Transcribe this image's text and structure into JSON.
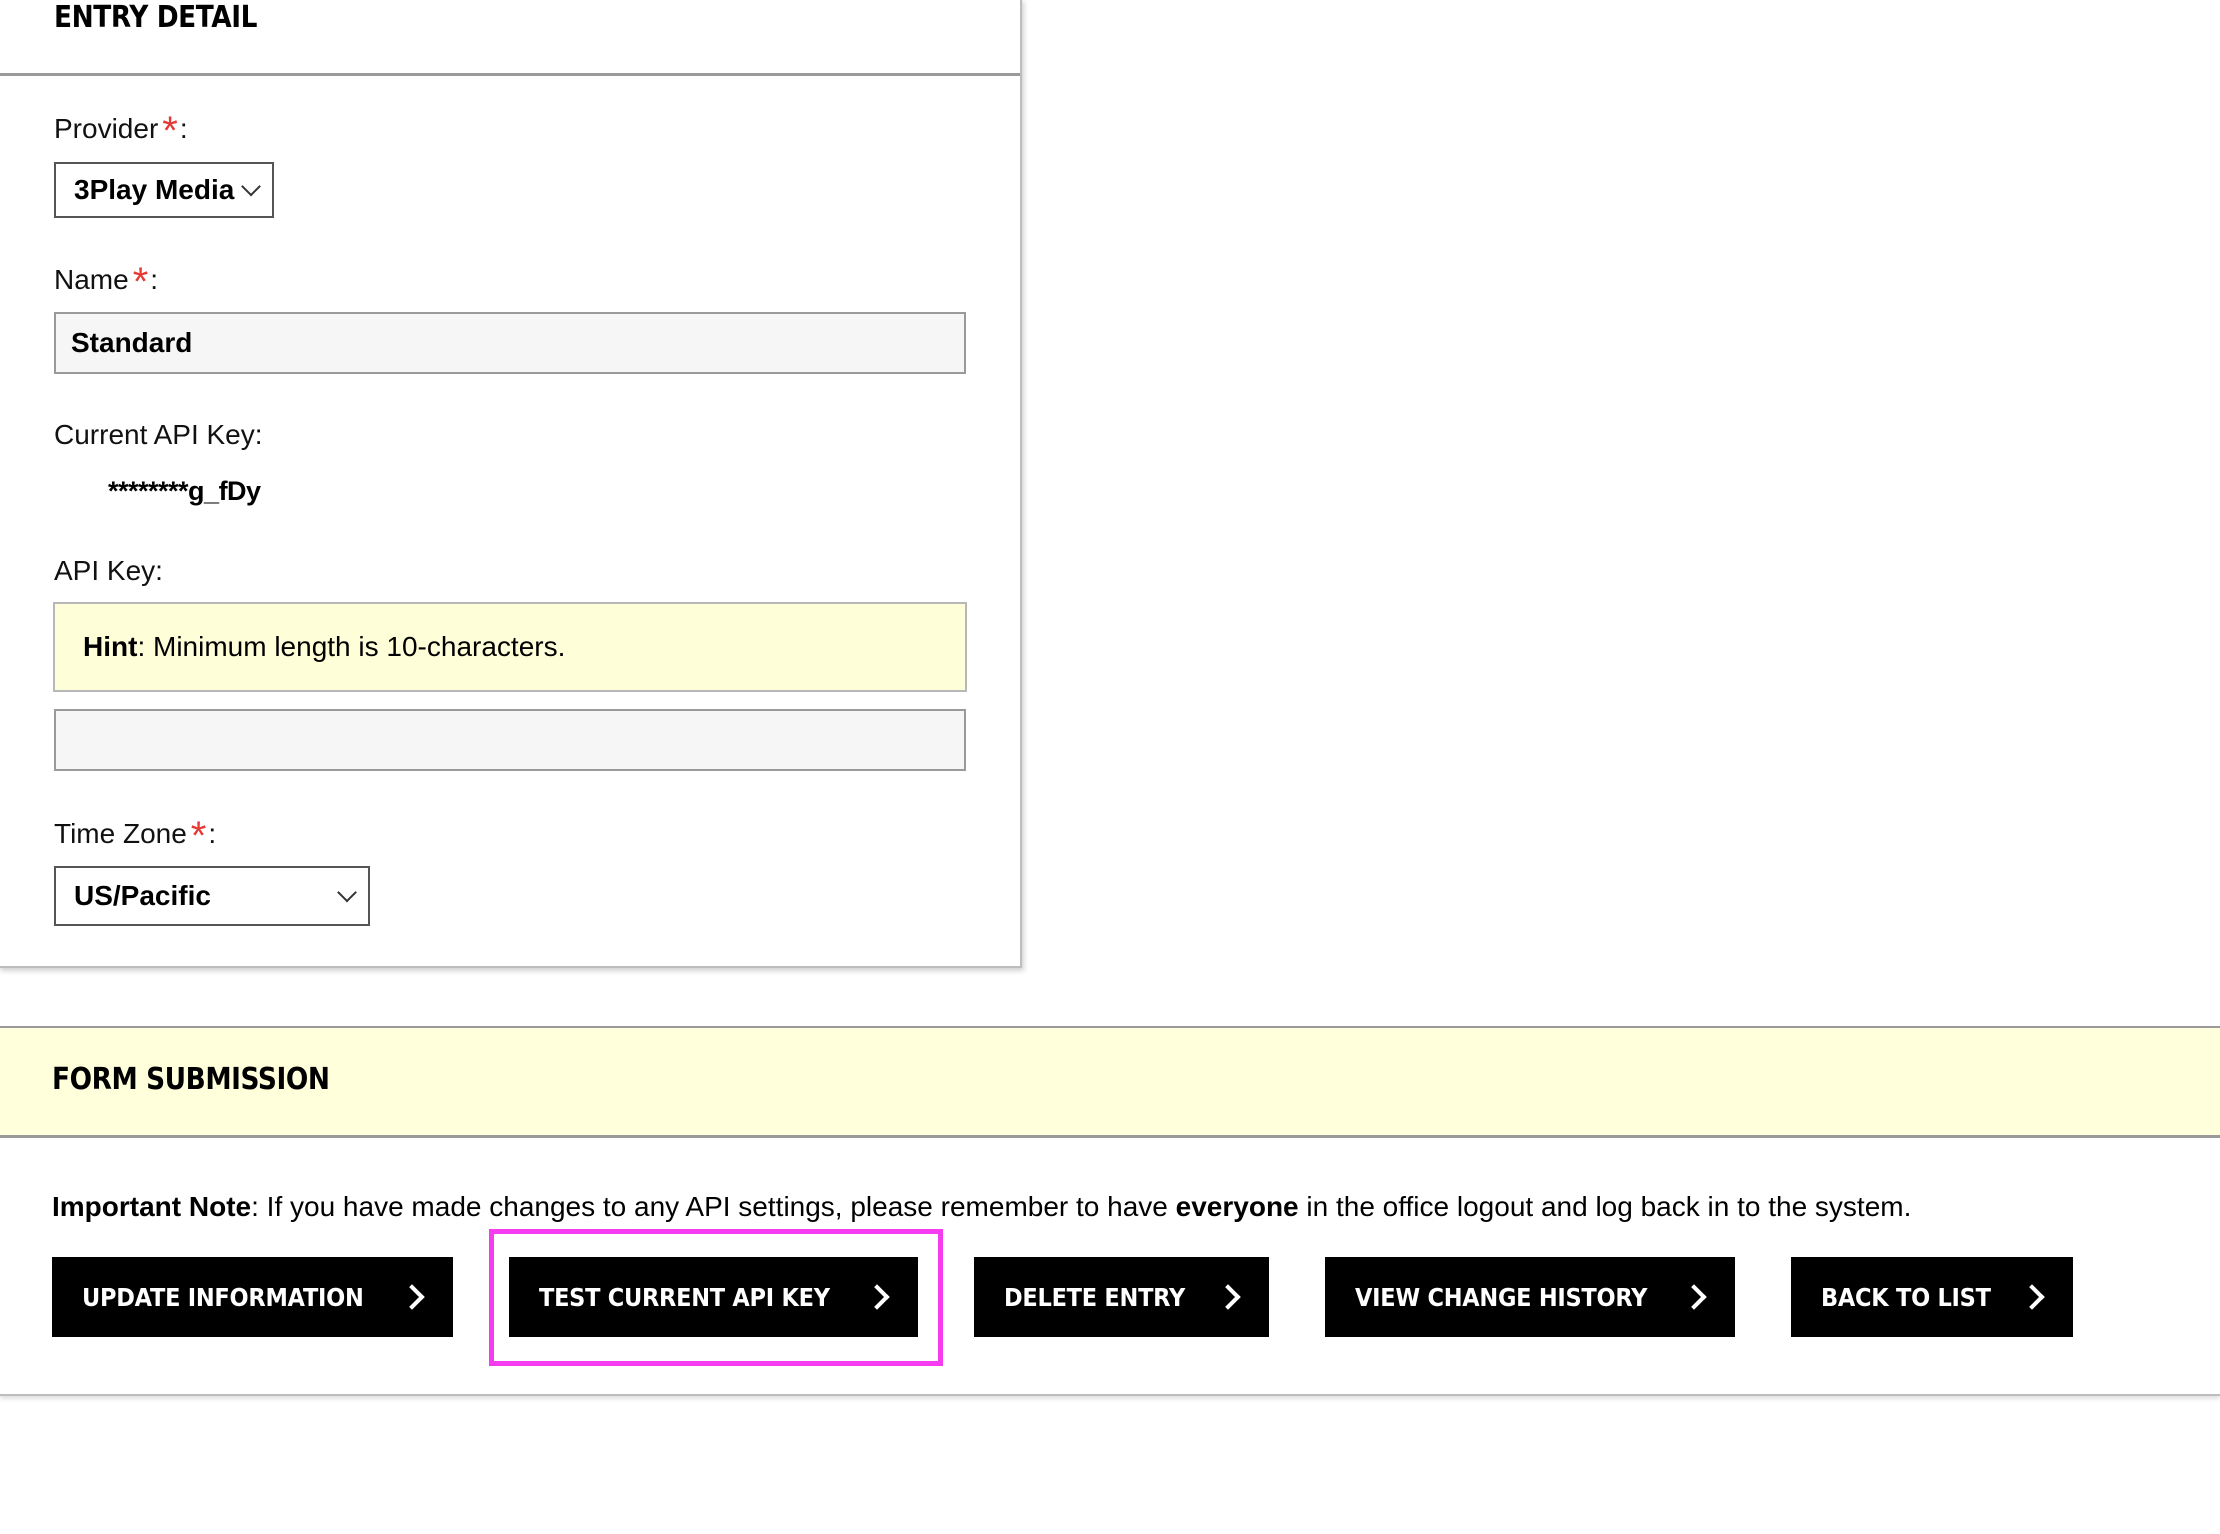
{
  "entry_detail": {
    "title": "ENTRY DETAIL",
    "provider": {
      "label": "Provider",
      "required_mark": "*",
      "colon": ":",
      "selected": "3Play Media"
    },
    "name": {
      "label": "Name",
      "required_mark": "*",
      "colon": ":",
      "value": "Standard"
    },
    "current_api_key": {
      "label": "Current API Key:",
      "value": "********g_fDy"
    },
    "api_key": {
      "label": "API Key:",
      "hint_bold": "Hint",
      "hint_text": ": Minimum length is 10-characters.",
      "value": ""
    },
    "time_zone": {
      "label": "Time Zone",
      "required_mark": "*",
      "colon": ":",
      "selected": "US/Pacific"
    }
  },
  "form_submission": {
    "title": "FORM SUBMISSION",
    "note": {
      "bold_prefix": "Important Note",
      "text_before": ": If you have made changes to any API settings, please remember to have ",
      "bold_mid": "everyone",
      "text_after": " in the office logout and log back in to the system."
    },
    "buttons": {
      "update": "UPDATE INFORMATION",
      "test_key": "TEST CURRENT API KEY",
      "delete": "DELETE ENTRY",
      "history": "VIEW CHANGE HISTORY",
      "back": "BACK TO LIST"
    }
  },
  "colors": {
    "required": "#e53935",
    "hint_background": "#fefed8",
    "band_background": "#ffffdc",
    "button_background": "#000000",
    "highlight": "#f53cf0"
  },
  "icons": {
    "dropdown": "chevron-down-icon",
    "button_arrow": "chevron-right-icon"
  }
}
